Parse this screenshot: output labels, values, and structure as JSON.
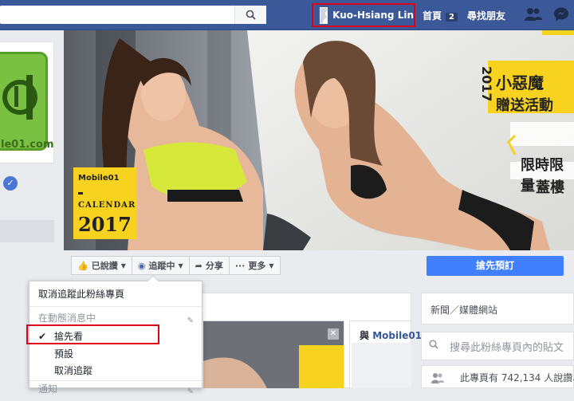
{
  "topbar": {
    "user_name": "Kuo-Hsiang Lin",
    "home_label": "首頁",
    "home_badge": "2",
    "find_friends_label": "尋找朋友"
  },
  "left": {
    "logo_text": "le01.com"
  },
  "cover": {
    "brand": "Mobile01",
    "calendar_label": "CALENDAR",
    "calendar_year": "2017",
    "banner_year": "2017",
    "banner_line1": "小惡魔",
    "banner_line2": "贈送活動",
    "banner_line3": "限時限量",
    "banner_line4": "蓋樓"
  },
  "actions": {
    "liked": "已說讚",
    "following": "追蹤中",
    "share": "分享",
    "more": "更多",
    "preorder": "搶先預訂"
  },
  "dropdown": {
    "unfollow_page": "取消追蹤此粉絲專頁",
    "section_news_feed": "在動態消息中",
    "see_first": "搶先看",
    "default": "預設",
    "unfollow": "取消追蹤",
    "section_notifications": "通知"
  },
  "content": {
    "with_prefix": "與",
    "with_name": "Mobile01",
    "sidebar_category": "新聞／媒體網站",
    "search_placeholder": "搜尋此粉絲專頁內的貼文",
    "likes_text": "此專頁有 742,134 人說讚、"
  },
  "colors": {
    "topbar": "#3b5998",
    "highlight": "#e0001a",
    "primary_button": "#4080ff",
    "banner_yellow": "#f7d21e"
  }
}
